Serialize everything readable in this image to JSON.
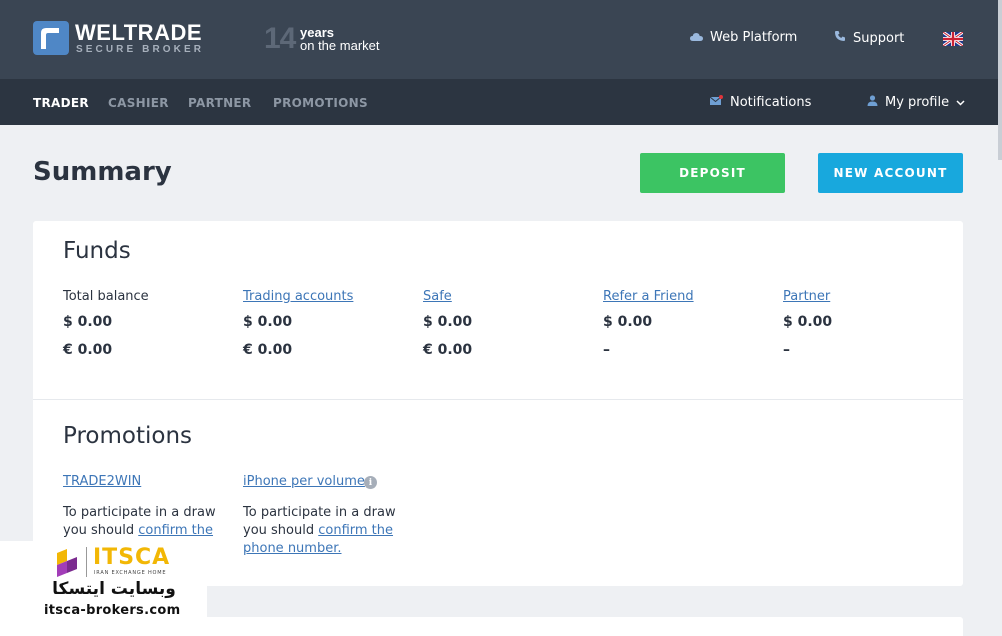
{
  "header": {
    "brand_name": "WELTRADE",
    "brand_tagline": "SECURE BROKER",
    "years_number": "14",
    "years_line1": "years",
    "years_line2": "on the market",
    "web_platform": "Web Platform",
    "support": "Support",
    "language": "English (UK flag)"
  },
  "nav": {
    "items": [
      "TRADER",
      "CASHIER",
      "PARTNER",
      "PROMOTIONS"
    ],
    "active": "TRADER",
    "notifications": "Notifications",
    "profile": "My profile"
  },
  "summary": {
    "title": "Summary",
    "deposit_button": "DEPOSIT",
    "new_account_button": "NEW ACCOUNT"
  },
  "funds": {
    "title": "Funds",
    "columns": [
      {
        "label": "Total balance",
        "link": false,
        "usd": "$ 0.00",
        "eur": "€ 0.00"
      },
      {
        "label": "Trading accounts",
        "link": true,
        "usd": "$ 0.00",
        "eur": "€ 0.00"
      },
      {
        "label": "Safe",
        "link": true,
        "usd": "$ 0.00",
        "eur": "€ 0.00"
      },
      {
        "label": "Refer a Friend",
        "link": true,
        "usd": "$ 0.00",
        "eur": "–"
      },
      {
        "label": "Partner",
        "link": true,
        "usd": "$ 0.00",
        "eur": "–"
      }
    ]
  },
  "promotions": {
    "title": "Promotions",
    "items": [
      {
        "name": "TRADE2WIN",
        "text_before": "To participate in a draw you should ",
        "link_text": "confirm the",
        "text_after": ""
      },
      {
        "name": "iPhone per volume",
        "text_before": "To participate in a draw you should ",
        "link_text": "confirm the phone number.",
        "text_after": ""
      }
    ]
  },
  "watermark": {
    "brand": "ITSCA",
    "subtitle": "IRAN EXCHANGE HOME",
    "farsi": "وبسایت ایتسکا",
    "url": "itsca-brokers.com"
  },
  "colors": {
    "header_bg": "#3a4553",
    "nav_bg": "#2c3541",
    "deposit_green": "#3cc463",
    "new_account_blue": "#18a8dd",
    "link_blue": "#3d76b7",
    "page_bg": "#eef0f3"
  },
  "icons": {
    "web_platform": "cloud-icon",
    "support": "phone-icon",
    "notifications": "envelope-icon",
    "profile": "user-icon",
    "profile_dropdown": "chevron-down-icon",
    "info": "info-icon"
  }
}
